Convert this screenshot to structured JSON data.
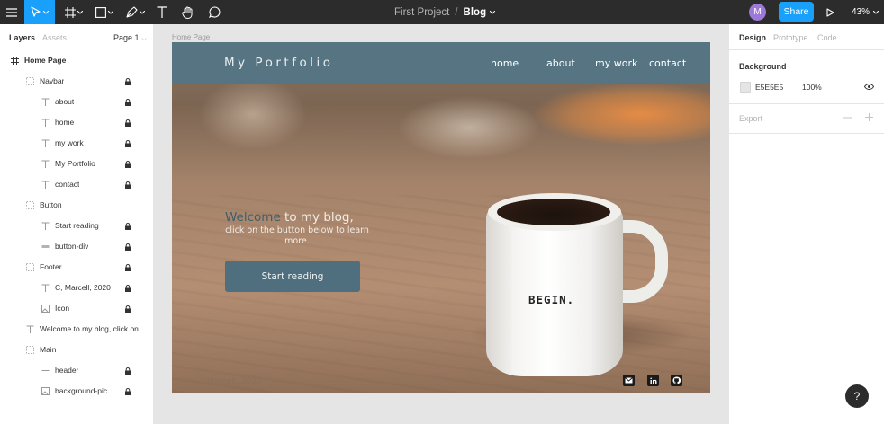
{
  "toolbar": {
    "project": "First Project",
    "separator": "/",
    "file": "Blog",
    "avatar_initial": "M",
    "share_label": "Share",
    "zoom": "43%",
    "tools": [
      "menu-icon",
      "move-tool-icon",
      "frame-tool-icon",
      "shape-tool-icon",
      "pen-tool-icon",
      "text-tool-icon",
      "hand-tool-icon",
      "comment-tool-icon",
      "play-icon"
    ],
    "accent": "#18a0fb"
  },
  "left_panel": {
    "tabs": [
      "Layers",
      "Assets"
    ],
    "page": "Page 1",
    "layers": [
      {
        "label": "Home Page",
        "icon": "frame-icon",
        "locked": false
      },
      {
        "label": "Navbar",
        "icon": "group-icon",
        "locked": true
      },
      {
        "label": "about",
        "icon": "text-icon",
        "locked": true
      },
      {
        "label": "home",
        "icon": "text-icon",
        "locked": true
      },
      {
        "label": "my work",
        "icon": "text-icon",
        "locked": true
      },
      {
        "label": "My Portfolio",
        "icon": "text-icon",
        "locked": true
      },
      {
        "label": "contact",
        "icon": "text-icon",
        "locked": true
      },
      {
        "label": "Button",
        "icon": "group-icon",
        "locked": false
      },
      {
        "label": "Start reading",
        "icon": "text-icon",
        "locked": true
      },
      {
        "label": "button-div",
        "icon": "rectangle-icon",
        "locked": true
      },
      {
        "label": "Footer",
        "icon": "group-icon",
        "locked": true
      },
      {
        "label": "C, Marcell, 2020",
        "icon": "text-icon",
        "locked": true
      },
      {
        "label": "Icon",
        "icon": "image-icon",
        "locked": true
      },
      {
        "label": "Welcome to my blog, click on ...",
        "icon": "text-icon",
        "locked": false
      },
      {
        "label": "Main",
        "icon": "group-icon",
        "locked": false
      },
      {
        "label": "header",
        "icon": "line-icon",
        "locked": true
      },
      {
        "label": "background-pic",
        "icon": "image-icon",
        "locked": true
      }
    ]
  },
  "canvas": {
    "frame_label": "Home Page",
    "brand": "My Portfolio",
    "nav_links": [
      "home",
      "about",
      "my work",
      "contact"
    ],
    "welcome_highlight": "Welcome",
    "welcome_rest": " to my blog,",
    "subtitle": "click on the button below to learn more.",
    "cta_label": "Start reading",
    "mug_text": "BEGIN.",
    "footer_text": "Marcell, 2020",
    "social_icons": [
      "mail-icon",
      "linkedin-icon",
      "github-icon"
    ],
    "navbar_color": "#567481",
    "button_color": "#4f6f7e"
  },
  "right_panel": {
    "tabs": [
      "Design",
      "Prototype",
      "Code"
    ],
    "background_heading": "Background",
    "background_hex": "E5E5E5",
    "background_opacity": "100%",
    "export_heading": "Export"
  },
  "help_label": "?"
}
